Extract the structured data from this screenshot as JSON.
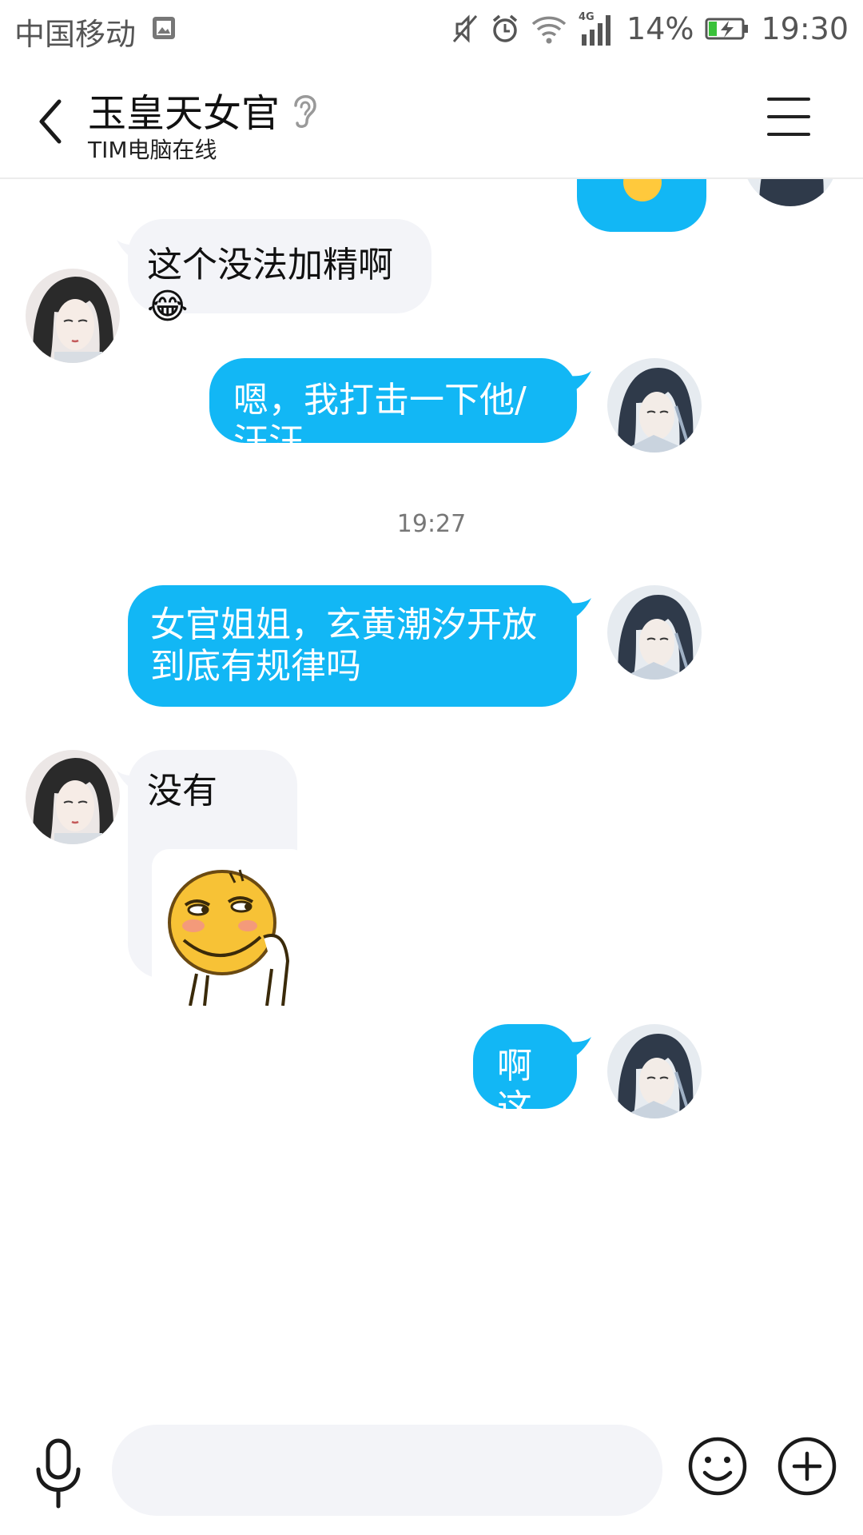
{
  "status_bar": {
    "carrier": "中国移动",
    "network": "4G",
    "battery": "14%",
    "time": "19:30",
    "icons": [
      "image-icon",
      "mute-icon",
      "alarm-icon",
      "wifi-icon",
      "signal-icon",
      "battery-charging-icon"
    ]
  },
  "header": {
    "title": "玉皇天女官",
    "subtitle": "TIM电脑在线",
    "icons": [
      "back-icon",
      "ear-icon",
      "menu-icon"
    ]
  },
  "chat": {
    "messages": [
      {
        "side": "in",
        "text": "这个没法加精啊😂"
      },
      {
        "side": "out",
        "text": "嗯，我打击一下他/汪汪"
      },
      {
        "timestamp": "19:27"
      },
      {
        "side": "out",
        "text": "女官姐姐，玄黄潮汐开放到底有规律吗"
      },
      {
        "side": "in",
        "text": "没有",
        "sticker": "smirk-emoji-sticker"
      },
      {
        "side": "out",
        "text": "啊这"
      }
    ]
  },
  "input_bar": {
    "placeholder": "",
    "icons": [
      "mic-icon",
      "emoji-icon",
      "plus-icon"
    ]
  },
  "colors": {
    "outgoing_bubble": "#12b7f5",
    "incoming_bubble": "#f3f4f8",
    "background": "#ffffff"
  }
}
